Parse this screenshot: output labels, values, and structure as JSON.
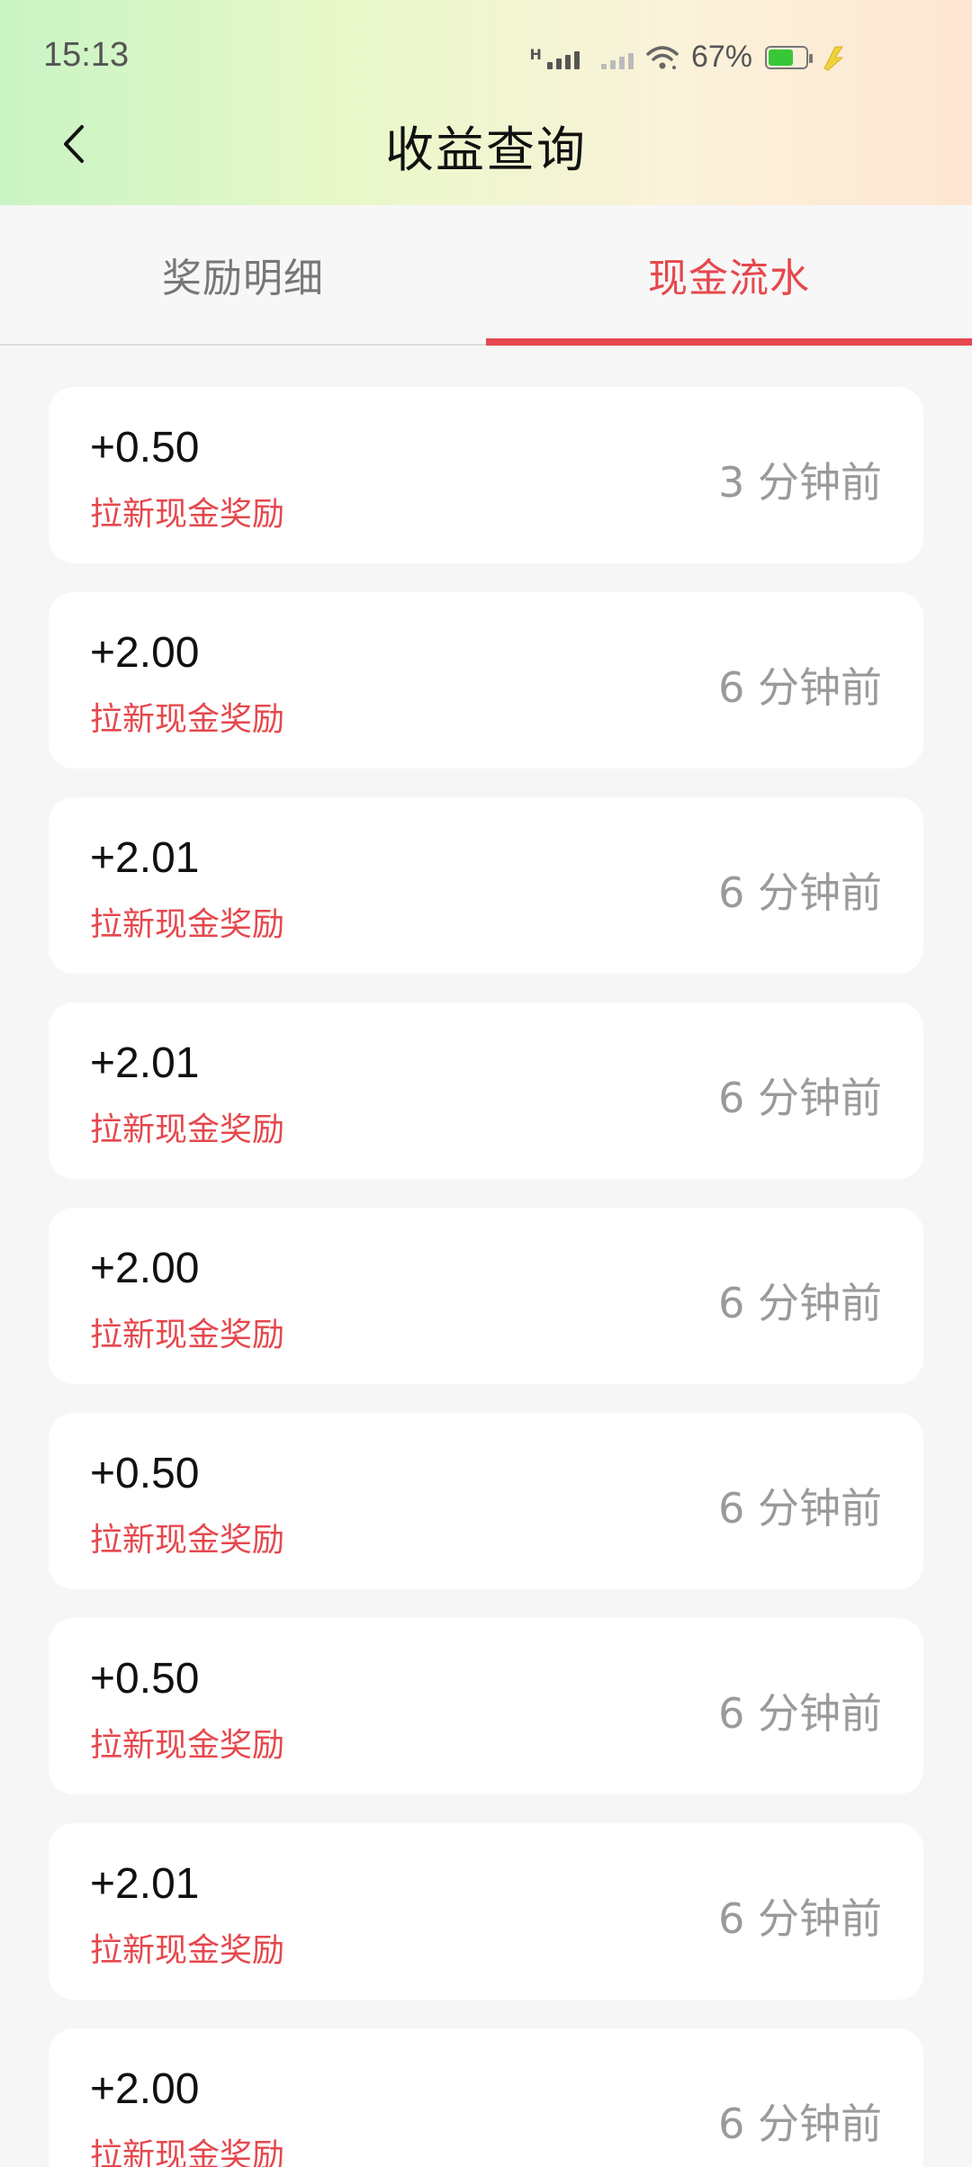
{
  "status_bar": {
    "time": "15:13",
    "network_type": "H",
    "battery_percent": "67%",
    "battery_level": 0.67,
    "icons": [
      "signal-icon",
      "signal-secondary-icon",
      "wifi-icon",
      "battery-icon",
      "charging-icon"
    ]
  },
  "header": {
    "title": "收益查询",
    "back_icon": "chevron-left-icon"
  },
  "tabs": [
    {
      "label": "奖励明细",
      "active": false
    },
    {
      "label": "现金流水",
      "active": true
    }
  ],
  "colors": {
    "accent": "#e5484d",
    "time_text": "#9a9a9a",
    "battery_fill": "#37c837"
  },
  "records": [
    {
      "amount": "+0.50",
      "desc": "拉新现金奖励",
      "time": "3 分钟前"
    },
    {
      "amount": "+2.00",
      "desc": "拉新现金奖励",
      "time": "6 分钟前"
    },
    {
      "amount": "+2.01",
      "desc": "拉新现金奖励",
      "time": "6 分钟前"
    },
    {
      "amount": "+2.01",
      "desc": "拉新现金奖励",
      "time": "6 分钟前"
    },
    {
      "amount": "+2.00",
      "desc": "拉新现金奖励",
      "time": "6 分钟前"
    },
    {
      "amount": "+0.50",
      "desc": "拉新现金奖励",
      "time": "6 分钟前"
    },
    {
      "amount": "+0.50",
      "desc": "拉新现金奖励",
      "time": "6 分钟前"
    },
    {
      "amount": "+2.01",
      "desc": "拉新现金奖励",
      "time": "6 分钟前"
    },
    {
      "amount": "+2.00",
      "desc": "拉新现金奖励",
      "time": "6 分钟前"
    }
  ]
}
